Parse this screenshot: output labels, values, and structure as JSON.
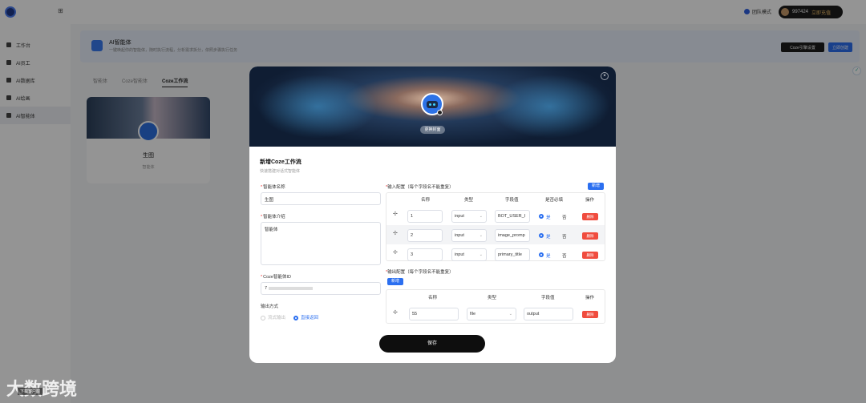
{
  "topbar": {
    "team_mode": "团队模式",
    "balance": "997424",
    "charge": "立即充值"
  },
  "sidebar": {
    "items": [
      {
        "label": "工作台",
        "active": false
      },
      {
        "label": "AI员工",
        "active": false
      },
      {
        "label": "AI数据库",
        "active": false
      },
      {
        "label": "AI绘画",
        "active": false
      },
      {
        "label": "AI智能体",
        "active": true
      }
    ]
  },
  "banner": {
    "title": "AI智能体",
    "subtitle": "一键唤起你的智能体，随时执行流程，分析需求拆分，依照步骤执行任务",
    "btn_coze": "Coze引擎设置",
    "btn_create": "立即创建"
  },
  "subtabs": [
    "智能体",
    "Coze智能体",
    "Coze工作流"
  ],
  "card": {
    "title": "生图",
    "subtitle": "智能体"
  },
  "modal": {
    "change_cover": "更换封面",
    "close": "×",
    "title": "新增Coze工作流",
    "subtitle": "快速搭建对话式智能体",
    "name_label": "智能体名称",
    "name_value": "生图",
    "intro_label": "智能体介绍",
    "intro_value": "智能体",
    "coze_id_label": "Coze智能体ID",
    "coze_id_value": "7",
    "output_mode_label": "输出方式",
    "output_stream": "流式输出",
    "output_direct": "直接返回",
    "input_title": "输入配置（每个字段名不能重复）",
    "add": "新增",
    "input_headers": [
      "名称",
      "类型",
      "字段值",
      "是否必填",
      "操作"
    ],
    "input_rows": [
      {
        "name": "1",
        "type": "input",
        "field": "BOT_USER_I",
        "yes": "是",
        "no": "否",
        "del": "删除"
      },
      {
        "name": "2",
        "type": "input",
        "field": "image_promp",
        "yes": "是",
        "no": "否",
        "del": "删除"
      },
      {
        "name": "3",
        "type": "input",
        "field": "primary_title",
        "yes": "是",
        "no": "否",
        "del": "删除"
      }
    ],
    "output_title": "输出配置（每个字段名不能重复）",
    "output_headers": [
      "名称",
      "类型",
      "字段值",
      "操作"
    ],
    "output_rows": [
      {
        "name": "55",
        "type": "file",
        "field": "output",
        "del": "删除"
      }
    ],
    "save": "保存"
  },
  "watermark": {
    "brand": "大数跨境",
    "sub": "下载客户端"
  }
}
